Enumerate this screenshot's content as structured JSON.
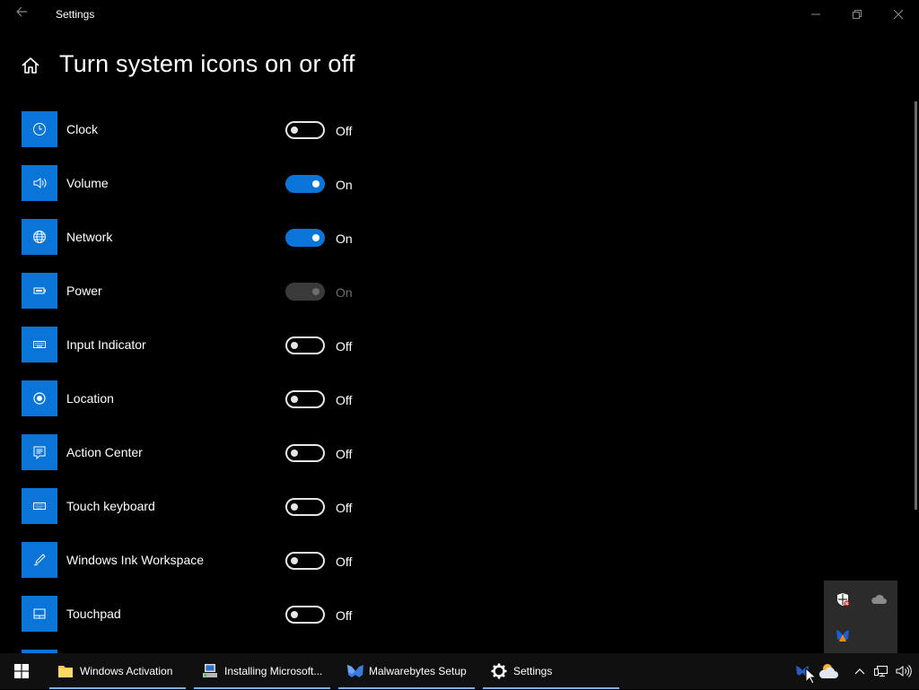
{
  "window": {
    "title": "Settings"
  },
  "page": {
    "title": "Turn system icons on or off"
  },
  "items": [
    {
      "label": "Clock",
      "state": "Off",
      "on": false,
      "disabled": false,
      "icon": "clock-icon"
    },
    {
      "label": "Volume",
      "state": "On",
      "on": true,
      "disabled": false,
      "icon": "volume-icon"
    },
    {
      "label": "Network",
      "state": "On",
      "on": true,
      "disabled": false,
      "icon": "globe-icon"
    },
    {
      "label": "Power",
      "state": "On",
      "on": true,
      "disabled": true,
      "icon": "battery-icon"
    },
    {
      "label": "Input Indicator",
      "state": "Off",
      "on": false,
      "disabled": false,
      "icon": "keyboard-icon"
    },
    {
      "label": "Location",
      "state": "Off",
      "on": false,
      "disabled": false,
      "icon": "location-icon"
    },
    {
      "label": "Action Center",
      "state": "Off",
      "on": false,
      "disabled": false,
      "icon": "message-icon"
    },
    {
      "label": "Touch keyboard",
      "state": "Off",
      "on": false,
      "disabled": false,
      "icon": "touch-keyboard-icon"
    },
    {
      "label": "Windows Ink Workspace",
      "state": "Off",
      "on": false,
      "disabled": false,
      "icon": "pen-icon"
    },
    {
      "label": "Touchpad",
      "state": "Off",
      "on": false,
      "disabled": false,
      "icon": "touchpad-icon"
    }
  ],
  "taskbar": {
    "items": [
      {
        "label": "Windows Activation",
        "icon": "folder-icon"
      },
      {
        "label": "Installing Microsoft...",
        "icon": "installer-icon"
      },
      {
        "label": "Malwarebytes Setup",
        "icon": "malwarebytes-icon"
      },
      {
        "label": "Settings",
        "icon": "gear-icon"
      }
    ]
  },
  "tray_popup": {
    "icons": [
      "security-shield-icon",
      "onedrive-cloud-icon",
      "malwarebytes-tray-icon"
    ]
  },
  "colors": {
    "accent": "#0a74d9",
    "background": "#000000",
    "taskbar": "#101010"
  }
}
